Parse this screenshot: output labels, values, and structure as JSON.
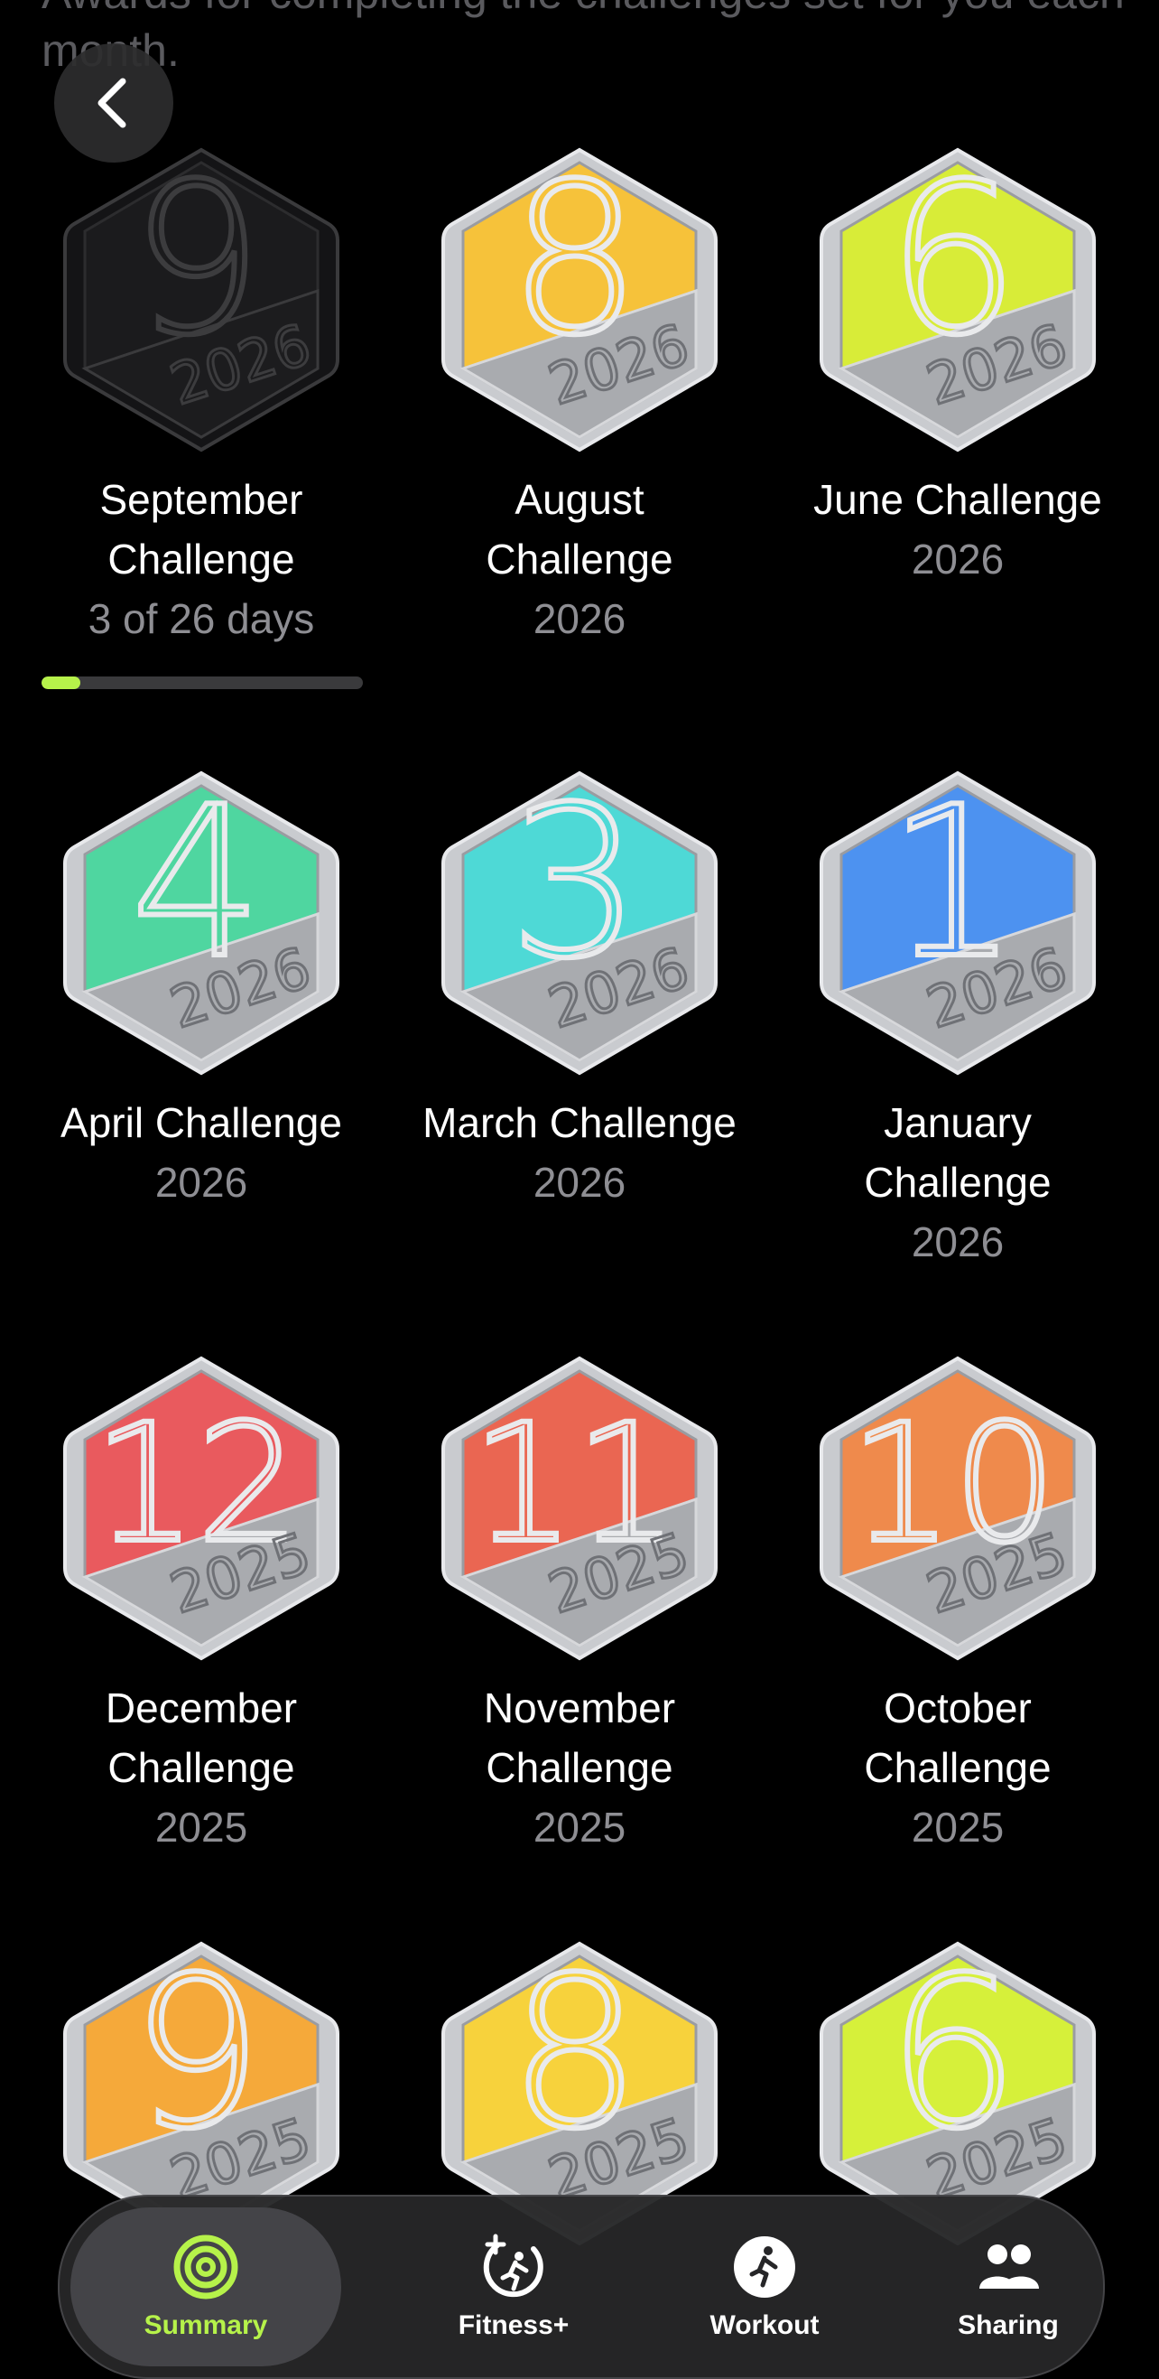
{
  "header": {
    "description": "Awards for completing the challenges set for you each month."
  },
  "awards": [
    {
      "title": "September Challenge",
      "sub": "3 of 26 days",
      "numeral": "9",
      "year": "2026",
      "color": "#1b1b1d",
      "locked": true,
      "progress": 0.12
    },
    {
      "title": "August Challenge",
      "sub": "2026",
      "numeral": "8",
      "year": "2026",
      "color": "#f6c23a",
      "locked": false
    },
    {
      "title": "June Challenge",
      "sub": "2026",
      "numeral": "6",
      "year": "2026",
      "color": "#d8ec38",
      "locked": false
    },
    {
      "title": "April Challenge",
      "sub": "2026",
      "numeral": "4",
      "year": "2026",
      "color": "#4fd6a0",
      "locked": false
    },
    {
      "title": "March Challenge",
      "sub": "2026",
      "numeral": "3",
      "year": "2026",
      "color": "#4ed9d6",
      "locked": false
    },
    {
      "title": "January Challenge",
      "sub": "2026",
      "numeral": "1",
      "year": "2026",
      "color": "#4d92f0",
      "locked": false
    },
    {
      "title": "December Challenge",
      "sub": "2025",
      "numeral": "12",
      "year": "2025",
      "color": "#e95a5e",
      "locked": false
    },
    {
      "title": "November Challenge",
      "sub": "2025",
      "numeral": "11",
      "year": "2025",
      "color": "#ea6652",
      "locked": false
    },
    {
      "title": "October Challenge",
      "sub": "2025",
      "numeral": "10",
      "year": "2025",
      "color": "#ef8a4c",
      "locked": false
    },
    {
      "title": "",
      "sub": "",
      "numeral": "9",
      "year": "2025",
      "color": "#f5a93a",
      "locked": false
    },
    {
      "title": "",
      "sub": "",
      "numeral": "8",
      "year": "2025",
      "color": "#f7d23c",
      "locked": false
    },
    {
      "title": "",
      "sub": "",
      "numeral": "6",
      "year": "2025",
      "color": "#d6f03a",
      "locked": false
    }
  ],
  "tabbar": {
    "summary": "Summary",
    "fitness": "Fitness+",
    "workout": "Workout",
    "sharing": "Sharing",
    "accent": "#b6f24a"
  }
}
